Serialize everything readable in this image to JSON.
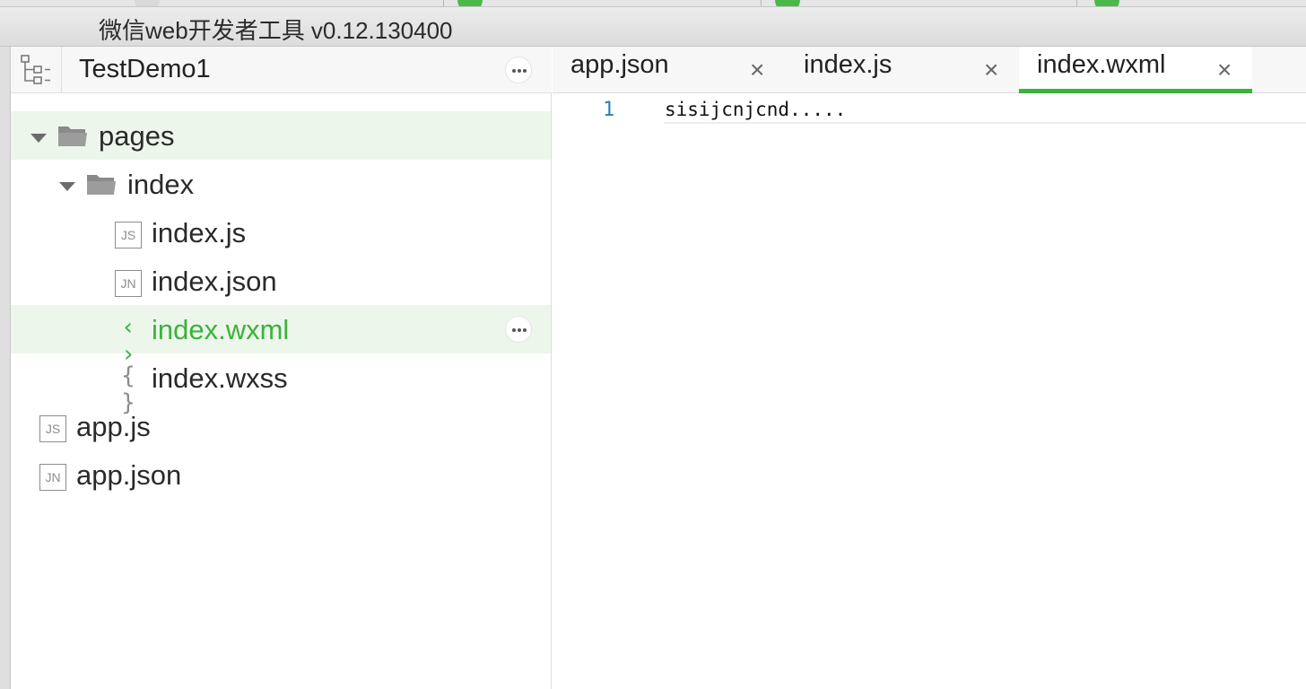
{
  "window": {
    "title": "微信web开发者工具 v0.12.130400"
  },
  "sidebar": {
    "project_name": "TestDemo1",
    "tree": [
      {
        "label": "pages",
        "kind": "folder",
        "expanded": true
      },
      {
        "label": "index",
        "kind": "folder",
        "expanded": true
      },
      {
        "label": "index.js",
        "kind": "file",
        "icon": "JS"
      },
      {
        "label": "index.json",
        "kind": "file",
        "icon": "JN"
      },
      {
        "label": "index.wxml",
        "kind": "file",
        "icon": "‹ ›",
        "active": true
      },
      {
        "label": "index.wxss",
        "kind": "file",
        "icon": "{ }"
      },
      {
        "label": "app.js",
        "kind": "file",
        "icon": "JS"
      },
      {
        "label": "app.json",
        "kind": "file",
        "icon": "JN"
      }
    ]
  },
  "editor": {
    "tabs": [
      {
        "label": "app.json",
        "close": "×"
      },
      {
        "label": "index.js",
        "close": "×"
      },
      {
        "label": "index.wxml",
        "close": "×",
        "active": true
      }
    ],
    "lines": [
      {
        "number": "1",
        "text": "sisijcnjcnd....."
      }
    ]
  },
  "colors": {
    "accent": "#3cb23c",
    "highlight_row": "#ecf6eb",
    "line_number": "#2f7fb1"
  }
}
